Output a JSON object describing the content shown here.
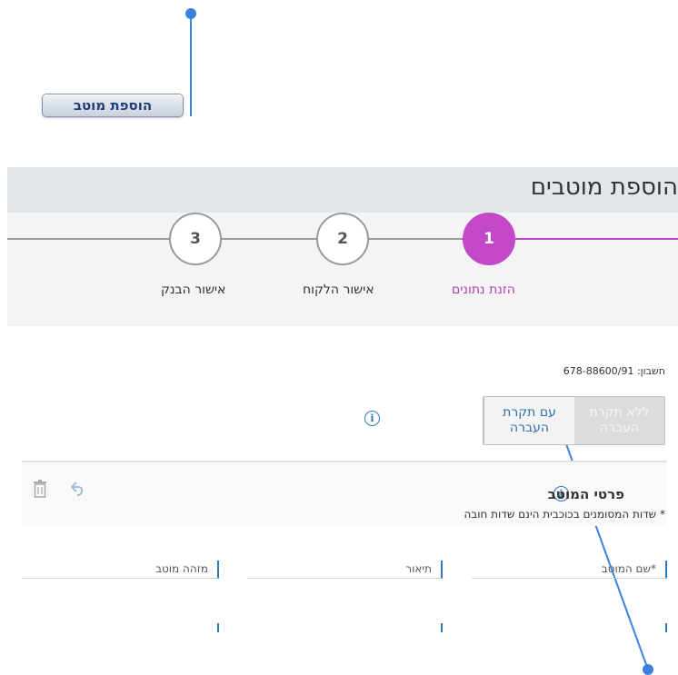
{
  "add_button": {
    "label": "הוספת מוטב"
  },
  "header": {
    "title": "הוספת מוטבים",
    "steps": [
      {
        "number": "1",
        "label": "הזנת נתונים",
        "active": true
      },
      {
        "number": "2",
        "label": "אישור הלקוח",
        "active": false
      },
      {
        "number": "3",
        "label": "אישור הבנק",
        "active": false
      }
    ]
  },
  "account": {
    "text": "חשבון: 678-88600/91"
  },
  "toggle": {
    "without_transfer": "ללא תקרת\nהעברה",
    "with_transfer": "עם תקרת\nהעברה"
  },
  "details": {
    "title": "פרטי המוטב",
    "required_note": "* שדות המסומנים בכוכבית הינם שדות חובה",
    "fields": [
      {
        "label": "*שם המוטב"
      },
      {
        "label": "תיאור"
      },
      {
        "label": "מזהה מוטב"
      }
    ]
  },
  "icons": {
    "info": "info-icon",
    "undo": "undo-icon",
    "trash": "trash-icon"
  },
  "colors": {
    "accent": "#c349c8",
    "link": "#2f78c4",
    "annotation": "#2f78c4"
  }
}
